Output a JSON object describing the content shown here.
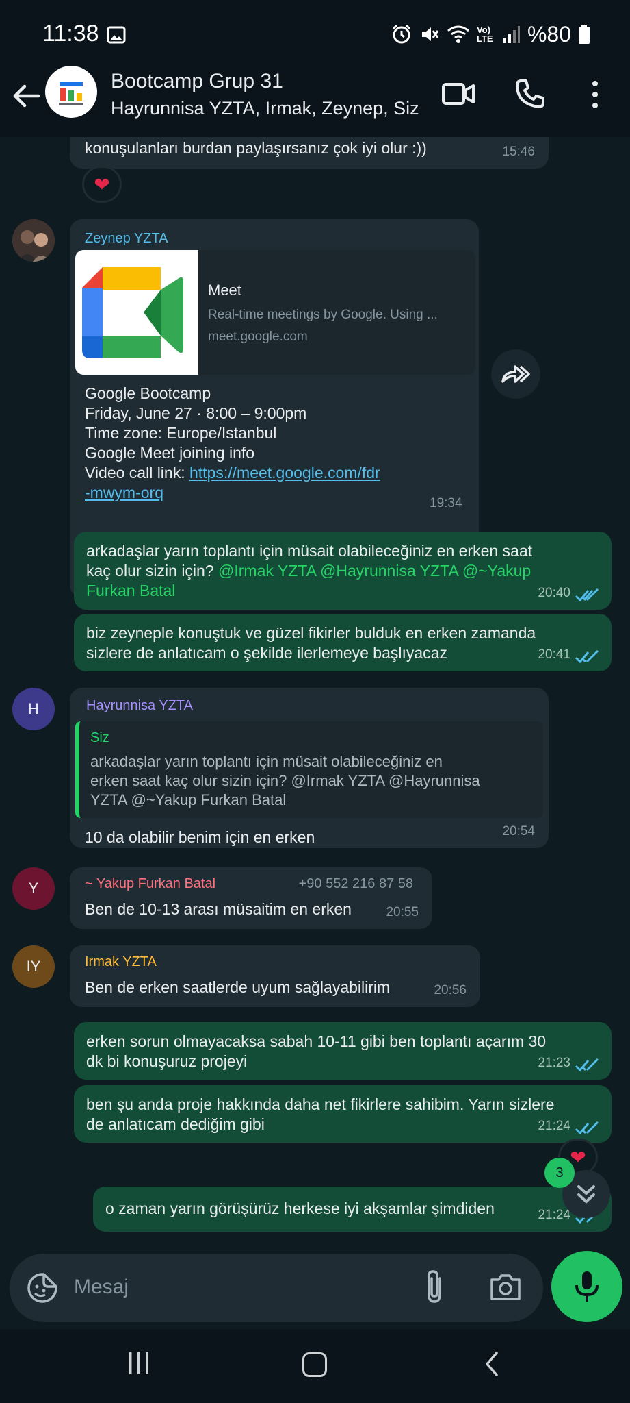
{
  "status_bar": {
    "time": "11:38",
    "battery_text": "%80",
    "network_label": "Vo) LTE"
  },
  "header": {
    "title": "Bootcamp Grup 31",
    "subtitle": "Hayrunnisa YZTA, Irmak, Zeynep, Siz"
  },
  "messages": {
    "m0": {
      "text": "konuşulanları burdan paylaşırsanız çok iyi olur :))",
      "time": "15:46",
      "reaction": "❤"
    },
    "m1": {
      "sender": "Zeynep YZTA",
      "preview_title": "Meet",
      "preview_desc": "Real-time meetings by Google. Using ...",
      "preview_url": "meet.google.com",
      "line1": "Google Bootcamp",
      "line2": "Friday, June 27 · 8:00 – 9:00pm",
      "line3": "Time zone: Europe/Istanbul",
      "line4": "Google Meet joining info",
      "link_prefix": "Video call link: ",
      "link_part1": "https://meet.google.com/fdr",
      "link_part2": "-mwym-orq",
      "time": "19:34"
    },
    "m2": {
      "text_line1": "arkadaşlar yarın toplantı için müsait olabileceğiniz en erken saat",
      "text_line2_plain": "kaç olur sizin için? ",
      "text_line2_mention": "@Irmak YZTA @Hayrunnisa YZTA @~Yakup",
      "text_line3_mention": "Furkan Batal",
      "time": "20:40"
    },
    "m3": {
      "text_line1": "biz zeyneple konuştuk ve güzel fikirler bulduk en erken zamanda",
      "text_line2": "sizlere de anlatıcam o şekilde ilerlemeye başlıyacaz",
      "time": "20:41"
    },
    "m4": {
      "avatar_letter": "H",
      "sender": "Hayrunnisa YZTA",
      "quote_name": "Siz",
      "quote_line1": "arkadaşlar yarın toplantı için müsait olabileceğiniz en",
      "quote_line2": "erken saat kaç olur sizin için? @Irmak YZTA @Hayrunnisa",
      "quote_line3": "YZTA @~Yakup Furkan Batal",
      "text": "10 da olabilir benim için en erken",
      "time": "20:54"
    },
    "m5": {
      "avatar_letter": "Y",
      "sender": "~ Yakup Furkan Batal",
      "phone": "+90 552 216 87 58",
      "text": "Ben de 10-13 arası müsaitim en erken",
      "time": "20:55"
    },
    "m6": {
      "avatar_letter": "IY",
      "sender": "Irmak YZTA",
      "text": "Ben de erken saatlerde uyum sağlayabilirim",
      "time": "20:56"
    },
    "m7": {
      "text_line1": "erken sorun olmayacaksa sabah 10-11 gibi ben toplantı açarım 30",
      "text_line2": "dk bi konuşuruz projeyi",
      "time": "21:23"
    },
    "m8": {
      "text_line1": "ben şu anda proje hakkında daha net fikirlere sahibim. Yarın sizlere",
      "text_line2": "de anlatıcam dediğim gibi",
      "time": "21:24",
      "reaction": "❤"
    },
    "m9": {
      "text": "o zaman yarın görüşürüz herkese iyi akşamlar şimdiden",
      "time": "21:24"
    }
  },
  "scroll_down": {
    "unread_count": "3"
  },
  "input": {
    "placeholder": "Mesaj"
  },
  "colors": {
    "accent_green": "#25d366",
    "outgoing_bubble": "#144d37",
    "incoming_bubble": "#202c33",
    "read_ticks": "#53bdeb",
    "zeynep_name": "#53bdeb",
    "hayrunnisa_name": "#a791ff",
    "yakup_name": "#ff6f7d",
    "irmak_name": "#ffbc38"
  },
  "icons": {
    "back": "back-arrow-icon",
    "video": "video-call-icon",
    "call": "phone-icon",
    "menu": "more-vert-icon",
    "emoji": "sticker-emoji-icon",
    "clip": "paperclip-icon",
    "camera": "camera-icon",
    "mic": "microphone-icon",
    "forward": "forward-icon",
    "scroll": "double-chevron-down-icon"
  }
}
